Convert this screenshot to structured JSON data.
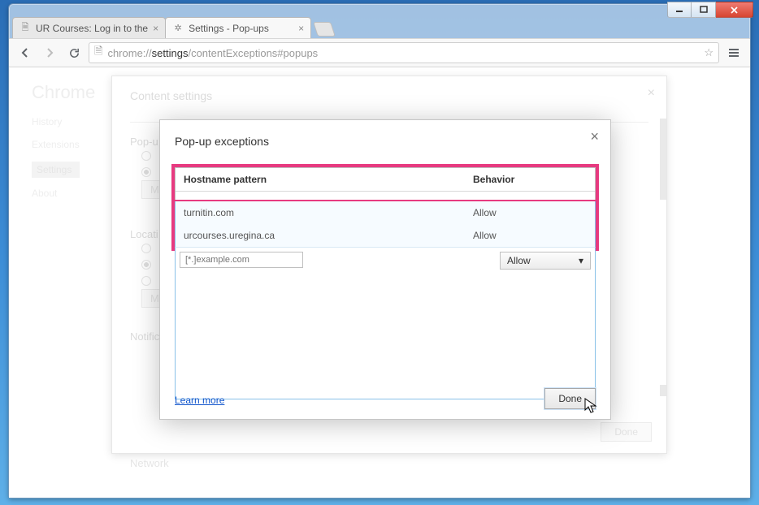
{
  "window": {
    "controls": {
      "min": "min",
      "max": "max",
      "close": "close"
    }
  },
  "tabs": [
    {
      "title": "UR Courses: Log in to the",
      "favicon": "page"
    },
    {
      "title": "Settings - Pop-ups",
      "favicon": "gear"
    }
  ],
  "url": {
    "prefix": "chrome://",
    "bold": "settings",
    "suffix": "/contentExceptions#popups"
  },
  "sidebar": {
    "brand": "Chrome",
    "items": [
      "History",
      "Extensions",
      "Settings",
      "About"
    ]
  },
  "content_settings": {
    "title": "Content settings",
    "sections": {
      "popups": "Pop-u",
      "location": "Locati",
      "notifications": "Notific",
      "network": "Network"
    },
    "manage_btn": "M",
    "done": "Done"
  },
  "popup_exceptions": {
    "title": "Pop-up exceptions",
    "columns": {
      "host": "Hostname pattern",
      "behavior": "Behavior"
    },
    "rows": [
      {
        "host": "turnitin.com",
        "behavior": "Allow"
      },
      {
        "host": "urcourses.uregina.ca",
        "behavior": "Allow"
      }
    ],
    "input_placeholder": "[*.]example.com",
    "behavior_default": "Allow",
    "learn_more": "Learn more",
    "done": "Done"
  }
}
